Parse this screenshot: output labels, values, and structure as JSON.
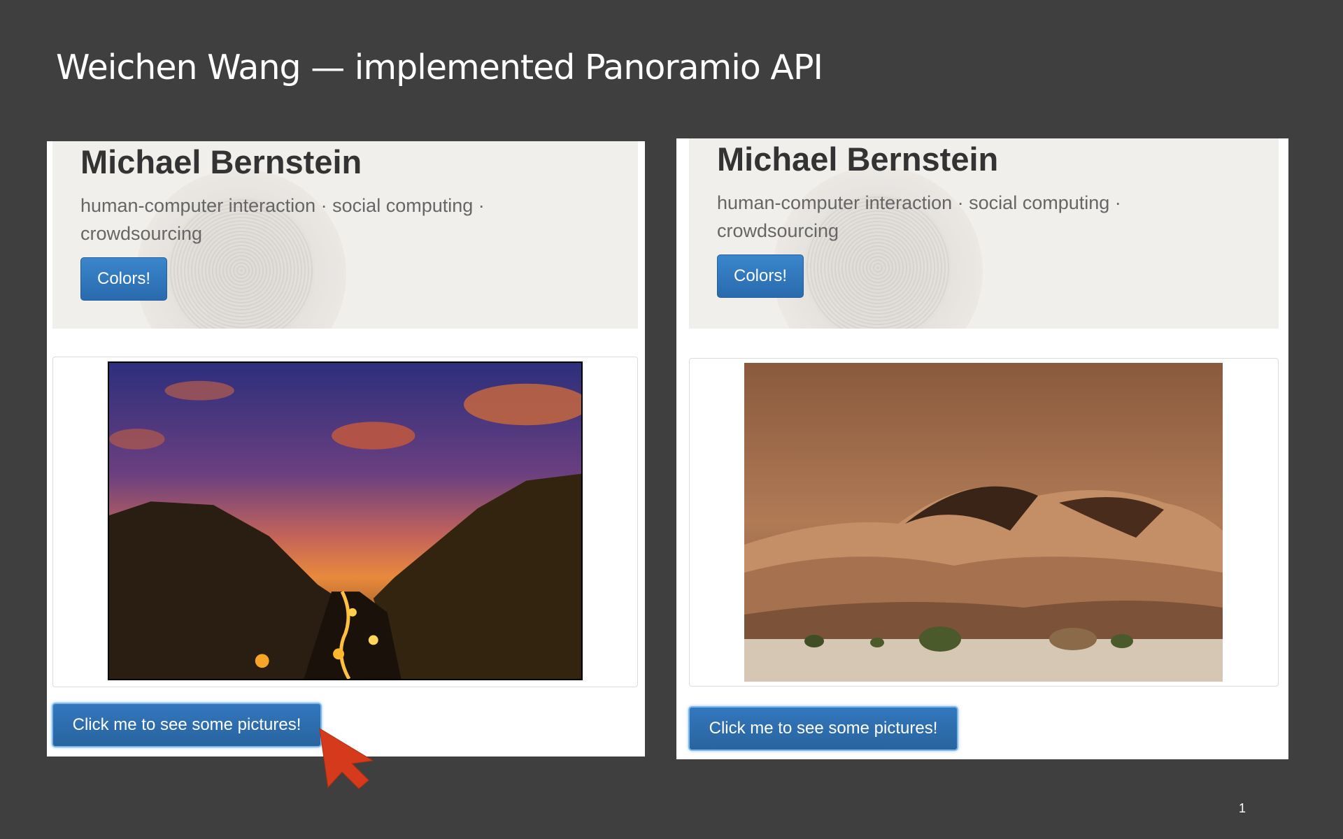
{
  "slide": {
    "title": "Weichen Wang — implemented Panoramio API",
    "page_number": "1"
  },
  "screenshots": [
    {
      "profile": {
        "name": "Michael Bernstein",
        "tagline": "human-computer interaction · social computing · crowdsourcing"
      },
      "buttons": {
        "colors_label": "Colors!",
        "show_pictures_label": "Click me to see some pictures!"
      },
      "photo": {
        "description": "night valley with lit town at sunset",
        "palette": [
          "#2f2f7a",
          "#7a3f7a",
          "#e0803a",
          "#2a1c10",
          "#f7b02a"
        ]
      }
    },
    {
      "profile": {
        "name": "Michael Bernstein",
        "tagline": "human-computer interaction · social computing · crowdsourcing"
      },
      "buttons": {
        "colors_label": "Colors!",
        "show_pictures_label": "Click me to see some pictures!"
      },
      "photo": {
        "description": "desert sand dunes with acacia trees",
        "palette": [
          "#8a5a3c",
          "#c48e67",
          "#3a2418",
          "#d9c9b5",
          "#4a5a2a"
        ]
      }
    }
  ],
  "colors": {
    "slide_background": "#3f3f3f",
    "button_primary": "#2f74b7",
    "cursor": "#d63a1c"
  },
  "icons": {
    "cursor": "mouse-pointer-icon"
  }
}
